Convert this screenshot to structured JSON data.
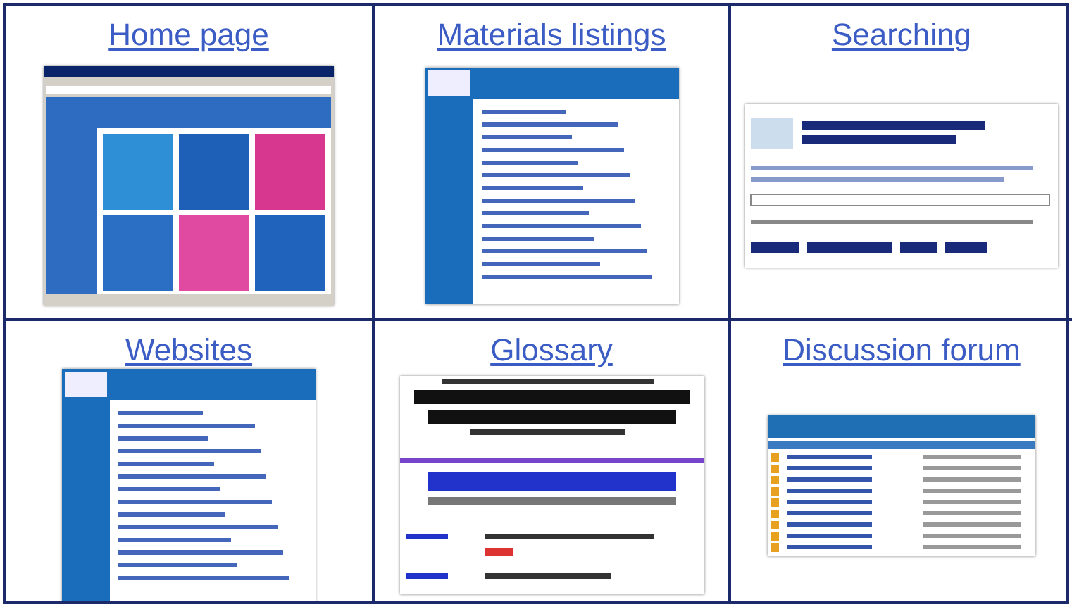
{
  "cells": [
    {
      "title": "Home page",
      "thumbnail": {
        "kind": "portal"
      }
    },
    {
      "title": "Materials listings",
      "thumbnail": {
        "kind": "listing"
      }
    },
    {
      "title": "Searching",
      "thumbnail": {
        "kind": "search"
      }
    },
    {
      "title": "Websites",
      "thumbnail": {
        "kind": "listing"
      }
    },
    {
      "title": "Glossary",
      "thumbnail": {
        "kind": "glossary"
      }
    },
    {
      "title": "Discussion forum",
      "thumbnail": {
        "kind": "forum"
      }
    }
  ]
}
